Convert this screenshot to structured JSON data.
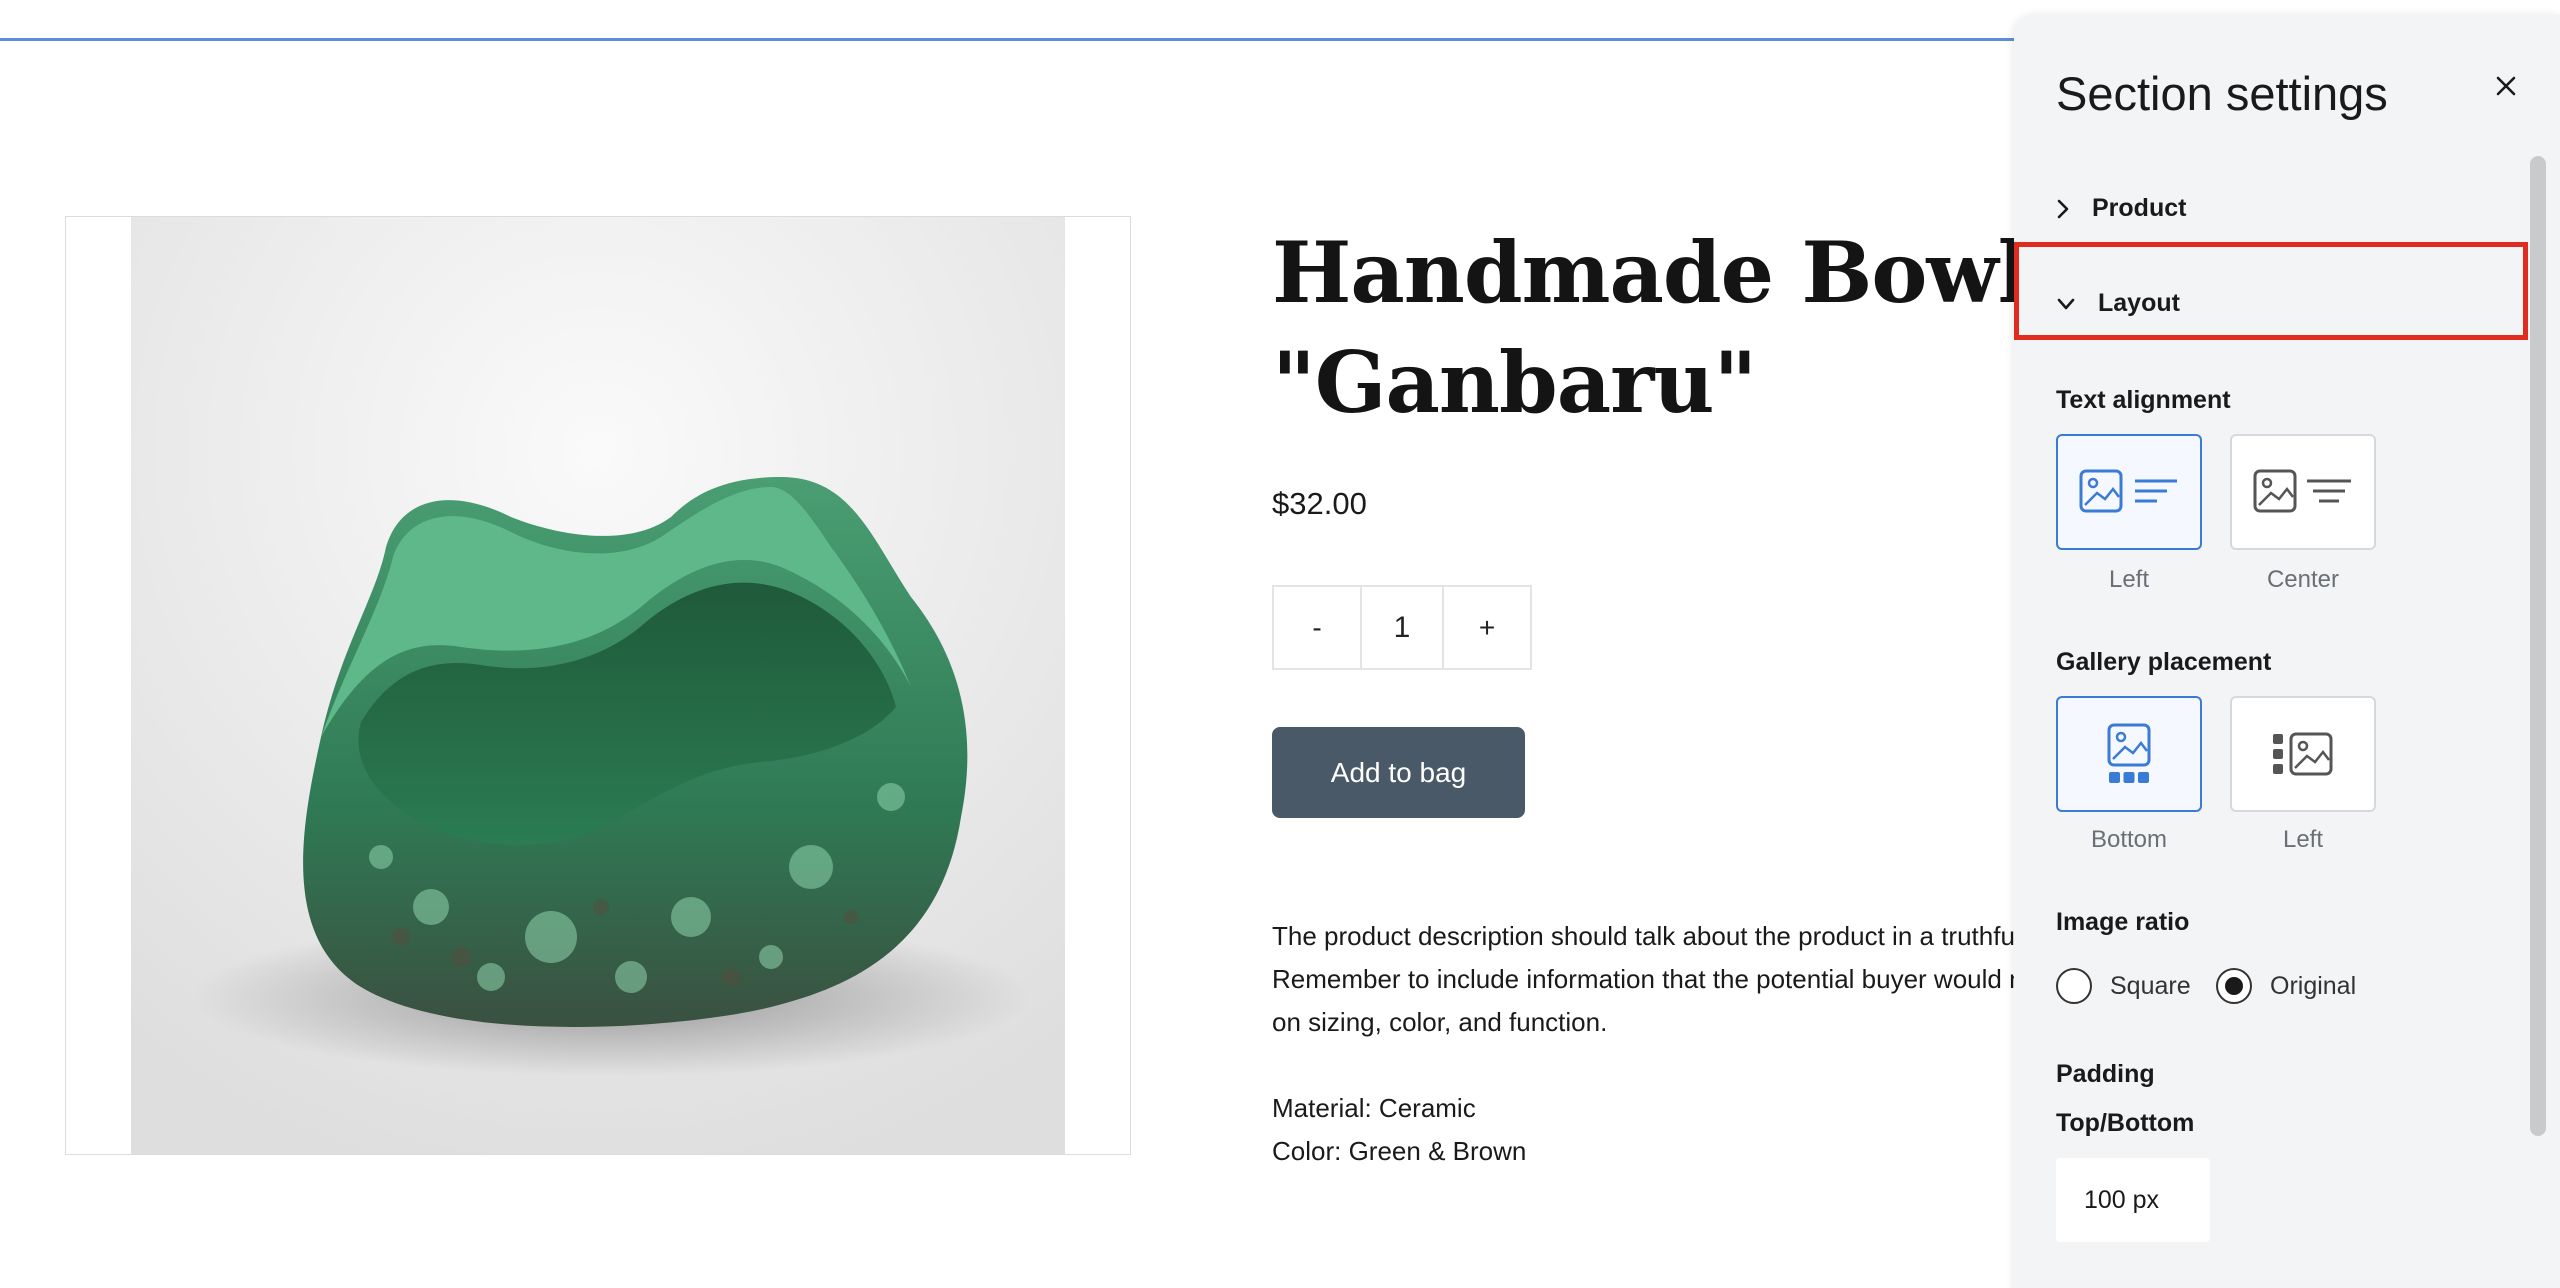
{
  "product": {
    "title_line1": "Handmade Bowl",
    "title_line2": "\"Ganbaru\"",
    "price": "$32.00",
    "quantity": {
      "minus": "-",
      "value": "1",
      "plus": "+"
    },
    "add_to_bag": "Add to bag",
    "description_lines": [
      "The product description should talk about the product in a truthful yet fl",
      "Remember to include information that the potential buyer would need,",
      "on sizing, color, and function."
    ],
    "material": "Material: Ceramic",
    "color": "Color: Green & Brown"
  },
  "panel": {
    "title": "Section settings",
    "sections": [
      {
        "label": "Product",
        "expanded": false
      },
      {
        "label": "Layout",
        "expanded": true
      }
    ],
    "text_alignment": {
      "label": "Text alignment",
      "options": [
        {
          "label": "Left",
          "selected": true
        },
        {
          "label": "Center",
          "selected": false
        }
      ]
    },
    "gallery_placement": {
      "label": "Gallery placement",
      "options": [
        {
          "label": "Bottom",
          "selected": true
        },
        {
          "label": "Left",
          "selected": false
        }
      ]
    },
    "image_ratio": {
      "label": "Image ratio",
      "options": [
        {
          "label": "Square",
          "selected": false
        },
        {
          "label": "Original",
          "selected": true
        }
      ]
    },
    "padding": {
      "label": "Padding",
      "sub_label": "Top/Bottom",
      "value": "100 px"
    }
  },
  "colors": {
    "accent_blue": "#3a7bd5",
    "highlight_red": "#e02b20",
    "button_dark": "#4a5967"
  }
}
